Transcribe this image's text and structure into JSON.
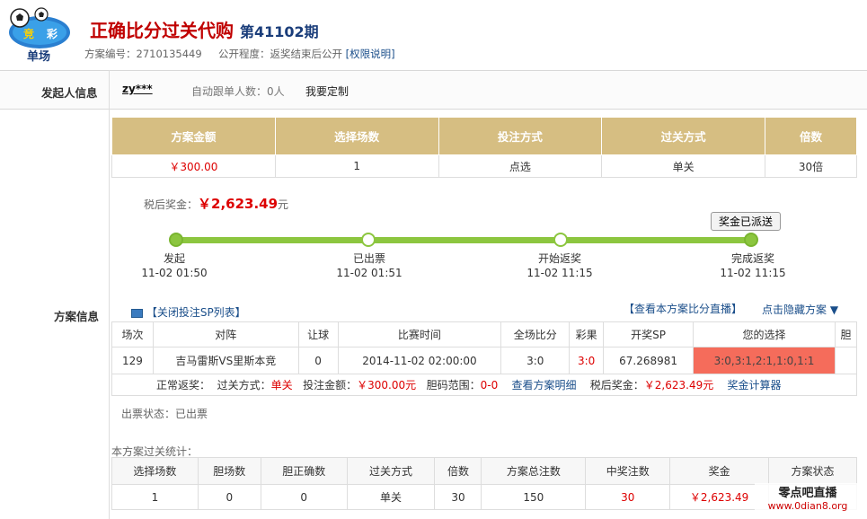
{
  "logo": {
    "badge": "单场",
    "icon": "soccer-ball-logo"
  },
  "header": {
    "title": "正确比分过关代购",
    "issue": "第41102期",
    "scheme_no_label": "方案编号：",
    "scheme_no": "2710135449",
    "visibility_label": "公开程度：",
    "visibility": "返奖结束后公开",
    "permission_link": "[权限说明]"
  },
  "initiator": {
    "section_label": "发起人信息",
    "user": "zy***",
    "auto_follow_label": "自动跟单人数：",
    "auto_follow": "0人",
    "custom_link": "我要定制"
  },
  "scheme": {
    "section_label": "方案信息",
    "summary_headers": [
      "方案金额",
      "选择场数",
      "投注方式",
      "过关方式",
      "倍数"
    ],
    "summary_values": [
      "￥300.00",
      "1",
      "点选",
      "单关",
      "30倍"
    ],
    "after_tax_label": "税后奖金：",
    "after_tax_amount": "￥2,623.49",
    "after_tax_unit": "元",
    "prize_sent_button": "奖金已派送",
    "stages": [
      {
        "label": "发起",
        "time": "11-02 01:50"
      },
      {
        "label": "已出票",
        "time": "11-02 01:51"
      },
      {
        "label": "开始返奖",
        "time": "11-02 11:15"
      },
      {
        "label": "完成返奖",
        "time": "11-02 11:15"
      }
    ],
    "close_sp_link": "【关闭投注SP列表】",
    "live_link": "【查看本方案比分直播】",
    "hide_link": "点击隐藏方案 ▼",
    "match_headers": [
      "场次",
      "对阵",
      "让球",
      "比赛时间",
      "全场比分",
      "彩果",
      "开奖SP",
      "您的选择",
      "胆"
    ],
    "match_row": [
      "129",
      "吉马雷斯VS里斯本竞",
      "0",
      "2014-11-02 02:00:00",
      "3:0",
      "3:0",
      "67.268981",
      "3:0,3:1,2:1,1:0,1:1",
      ""
    ],
    "footer": {
      "normal_label": "正常返奖：",
      "pass_label": "过关方式：",
      "pass_value": "单关",
      "bet_label": "投注金额：",
      "bet_value": "￥300.00元",
      "range_label": "胆码范围：",
      "range_value": "0-0",
      "detail_link": "查看方案明细",
      "after_tax_label": "税后奖金：",
      "after_tax_value": "￥2,623.49元",
      "calc_link": "奖金计算器"
    },
    "ticket_status_label": "出票状态：",
    "ticket_status": "已出票",
    "stats_title": "本方案过关统计：",
    "stat_headers": [
      "选择场数",
      "胆场数",
      "胆正确数",
      "过关方式",
      "倍数",
      "方案总注数",
      "中奖注数",
      "奖金",
      "方案状态"
    ],
    "stat_values": [
      "1",
      "0",
      "0",
      "单关",
      "30",
      "150",
      "30",
      "￥2,623.49",
      ""
    ]
  },
  "watermark": {
    "line1": "零点吧直播",
    "line2": "www.0dian8.org"
  },
  "colors": {
    "accent": "#d6be82",
    "progress": "#8cc63f",
    "highlight": "#f56c5b",
    "red": "#d00000"
  }
}
